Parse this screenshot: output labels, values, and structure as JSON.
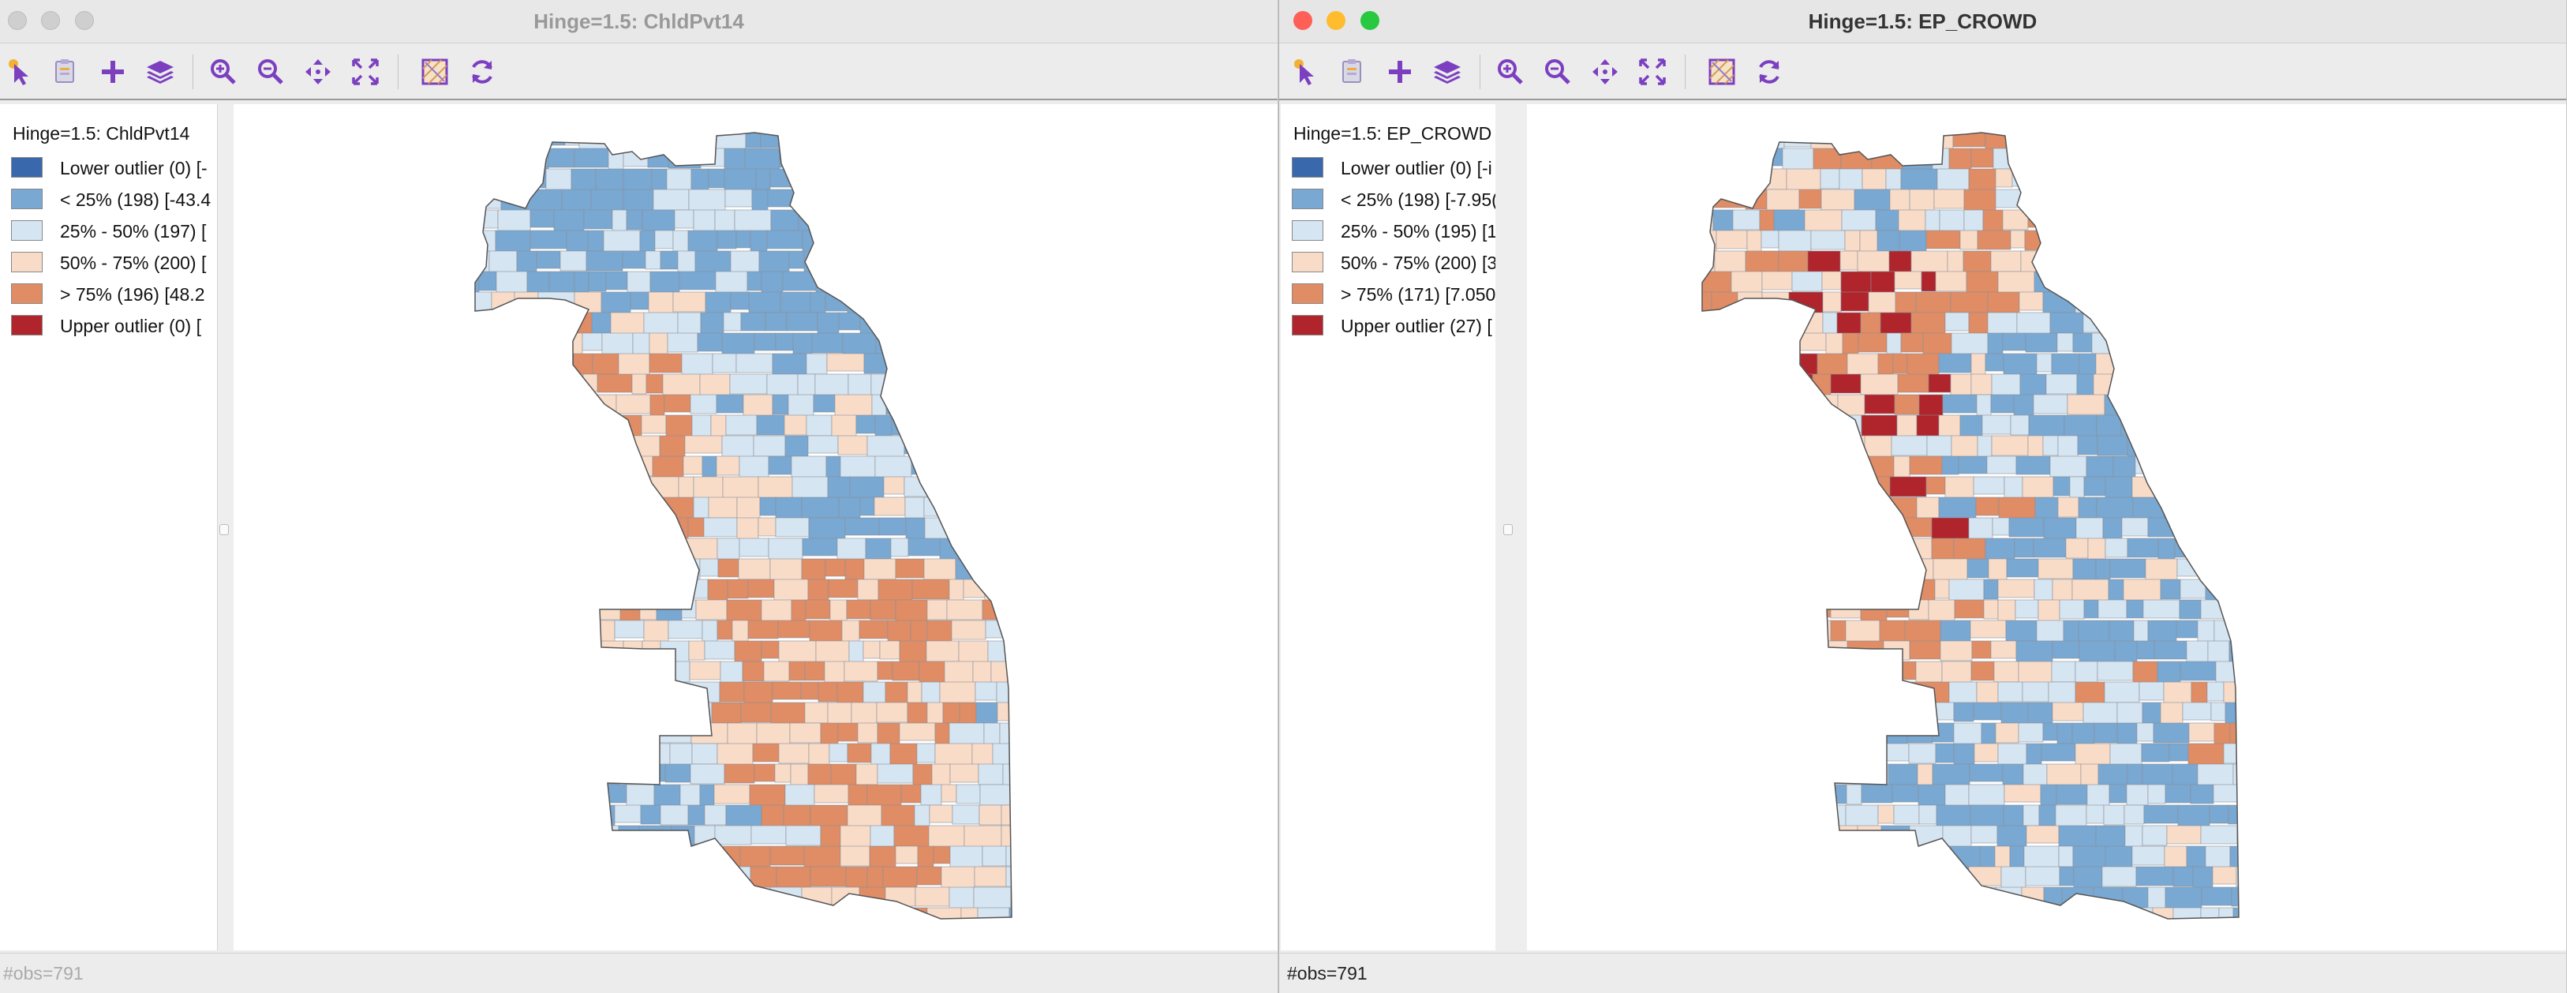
{
  "colors": {
    "lower_outlier": "#3a68ad",
    "lt25": "#79a8d2",
    "p25_50": "#d6e5f2",
    "p50_75": "#f9dcc8",
    "gt75": "#e08c64",
    "upper_outlier": "#b0242c",
    "tool_purple": "#7b3fc0"
  },
  "windows": [
    {
      "title": "Hinge=1.5: ChldPvt14",
      "active": false,
      "legend": {
        "title": "Hinge=1.5: ChldPvt14",
        "rows": [
          {
            "label": "Lower outlier (0)  [-",
            "color_key": "lower_outlier"
          },
          {
            "label": "< 25% (198)  [-43.4",
            "color_key": "lt25"
          },
          {
            "label": "25% - 50% (197)  [",
            "color_key": "p25_50"
          },
          {
            "label": "50% - 75% (200)  [",
            "color_key": "p50_75"
          },
          {
            "label": "> 75% (196)  [48.2",
            "color_key": "gt75"
          },
          {
            "label": "Upper outlier (0)  [",
            "color_key": "upper_outlier"
          }
        ]
      },
      "status": "#obs=791"
    },
    {
      "title": "Hinge=1.5: EP_CROWD",
      "active": true,
      "legend": {
        "title": "Hinge=1.5: EP_CROWD",
        "rows": [
          {
            "label": "Lower outlier (0)  [-i",
            "color_key": "lower_outlier"
          },
          {
            "label": "< 25% (198)  [-7.95(",
            "color_key": "lt25"
          },
          {
            "label": "25% - 50% (195)  [1",
            "color_key": "p25_50"
          },
          {
            "label": "50% - 75% (200)  [3",
            "color_key": "p50_75"
          },
          {
            "label": "> 75% (171)  [7.050",
            "color_key": "gt75"
          },
          {
            "label": "Upper outlier (27)  [",
            "color_key": "upper_outlier"
          }
        ]
      },
      "status": "#obs=791"
    }
  ],
  "toolbar_icons": [
    "select-pointer-icon",
    "copy-to-clipboard-icon",
    "add-plus-icon",
    "layers-icon",
    "zoom-in-icon",
    "zoom-out-icon",
    "pan-icon",
    "fit-extent-icon",
    "basemap-icon",
    "refresh-icon"
  ]
}
